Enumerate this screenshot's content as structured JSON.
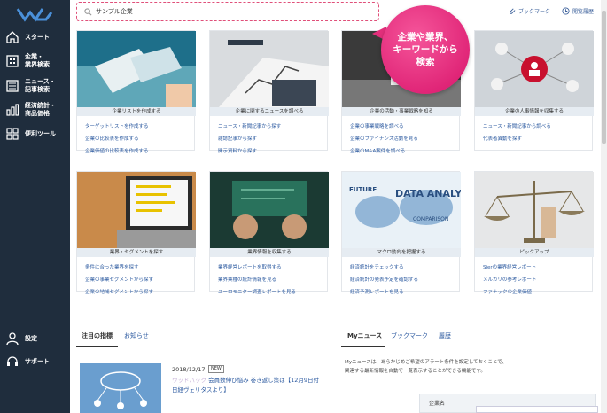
{
  "search": {
    "value": "サンプル企業"
  },
  "header": {
    "bookmark": "ブックマーク",
    "history": "閲覧履歴"
  },
  "callout": {
    "line1": "企業や業界、",
    "line2": "キーワードから",
    "line3": "検索"
  },
  "sidebar": {
    "items": [
      {
        "label1": "スタート",
        "label2": ""
      },
      {
        "label1": "企業・",
        "label2": "業界検索"
      },
      {
        "label1": "ニュース・",
        "label2": "記事検索"
      },
      {
        "label1": "経済統計・",
        "label2": "商品価格"
      },
      {
        "label1": "便利ツール",
        "label2": ""
      },
      {
        "label1": "設定",
        "label2": ""
      },
      {
        "label1": "サポート",
        "label2": ""
      }
    ]
  },
  "cards": [
    {
      "title": "企業リストを作成する",
      "links": [
        "ターゲットリストを作成する",
        "企業の比較表を作成する",
        "企業価値の比較表を作成する"
      ]
    },
    {
      "title": "企業に関するニュースを調べる",
      "links": [
        "ニュース・新聞記事から探す",
        "雑誌記事から探す",
        "開示資料から探す"
      ]
    },
    {
      "title": "企業の活動・事業戦略を知る",
      "links": [
        "企業の事業戦略を調べる",
        "企業のファイナンス活動を見る",
        "企業のM&A案件を調べる"
      ]
    },
    {
      "title": "企業の人事情報を収集する",
      "links": [
        "ニュース・新聞記事から調べる",
        "代表者異動を探す"
      ]
    },
    {
      "title": "業界・セグメントを探す",
      "links": [
        "条件に合った業界を探す",
        "企業の事業セグメントから探す",
        "企業の地域セグメントから探す"
      ]
    },
    {
      "title": "業界情報を収集する",
      "links": [
        "業界経営レポートを取得する",
        "業界業種の統計情報を見る",
        "ユーロモニター調査レポートを見る"
      ]
    },
    {
      "title": "マクロ動向を把握する",
      "links": [
        "経済統計をチェックする",
        "経済統計の発表予定を確認する",
        "経済予測レポートを見る"
      ]
    },
    {
      "title": "ピックアップ",
      "links": [
        "Sierの業界経営レポート",
        "メルカリの参考レポート",
        "ファナックの企業価値"
      ]
    }
  ],
  "bottom": {
    "left_tabs": [
      "注目の指標",
      "お知らせ"
    ],
    "right_tabs": [
      "Myニュース",
      "ブックマーク",
      "履歴"
    ],
    "news_date": "2018/12/17",
    "news_badge": "NEW",
    "news_blurred": "ウッドバック",
    "news_text1": "会員数伸び悩み 巻き返し策は【12月9日付",
    "news_text2": "日経ヴェリタスより】",
    "mynews_text1": "Myニュースは、あらかじめご希望のアラート条件を設定しておくことで、",
    "mynews_text2": "関連する最新情報を自動で一覧表示することができる機能です。",
    "table_header": "企業名"
  }
}
